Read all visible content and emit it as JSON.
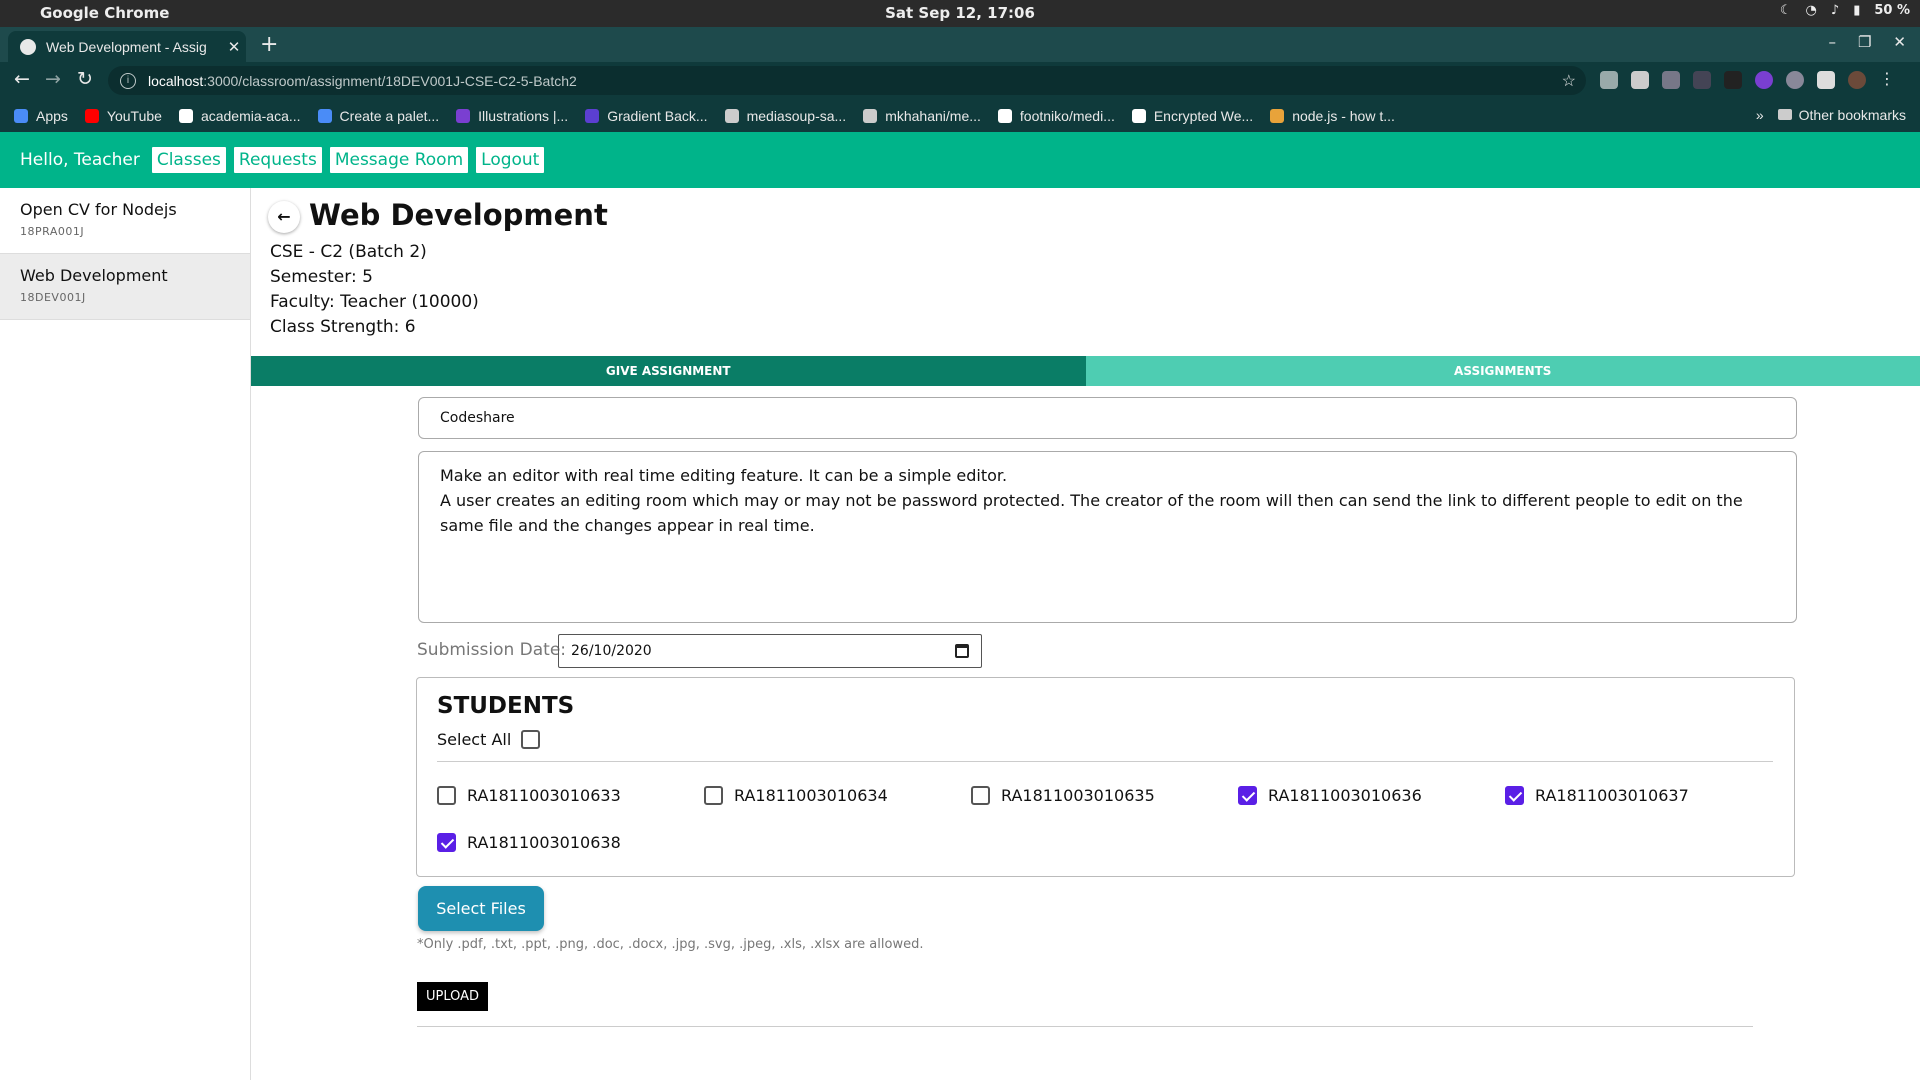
{
  "os": {
    "app_name": "Google Chrome",
    "clock": "Sat Sep 12, 17:06",
    "battery": "50 %"
  },
  "browser": {
    "tab_title": "Web Development - Assig",
    "url_host": "localhost",
    "url_rest": ":3000/classroom/assignment/18DEV001J-CSE-C2-5-Batch2",
    "bookmarks": [
      {
        "label": "Apps",
        "color": "#4a8cf7"
      },
      {
        "label": "YouTube",
        "color": "#ff0000"
      },
      {
        "label": "academia-aca...",
        "color": "#ffffff"
      },
      {
        "label": "Create a palet...",
        "color": "#4a8cf7"
      },
      {
        "label": "Illustrations |...",
        "color": "#7a3fd1"
      },
      {
        "label": "Gradient Back...",
        "color": "#5b3fd1"
      },
      {
        "label": "mediasoup-sa...",
        "color": "#cccccc"
      },
      {
        "label": "mkhahani/me...",
        "color": "#cccccc"
      },
      {
        "label": "footniko/medi...",
        "color": "#ffffff"
      },
      {
        "label": "Encrypted We...",
        "color": "#ffffff"
      },
      {
        "label": "node.js - how t...",
        "color": "#e8a33a"
      }
    ],
    "other_bookmarks": "Other bookmarks",
    "more": "»"
  },
  "header": {
    "greeting": "Hello, Teacher",
    "nav": [
      "Classes",
      "Requests",
      "Message Room",
      "Logout"
    ]
  },
  "sidebar": {
    "items": [
      {
        "name": "Open CV for Nodejs",
        "code": "18PRA001J",
        "active": false
      },
      {
        "name": "Web Development",
        "code": "18DEV001J",
        "active": true
      }
    ]
  },
  "course": {
    "title": "Web Development",
    "section": "CSE - C2 (Batch 2)",
    "semester": "Semester: 5",
    "faculty": "Faculty: Teacher (10000)",
    "strength": "Class Strength: 6"
  },
  "tabs": {
    "give": "GIVE ASSIGNMENT",
    "list": "ASSIGNMENTS"
  },
  "form": {
    "title_value": "Codeshare",
    "description_lines": [
      "Make an editor with real time editing feature. It can be a simple editor.",
      "A user creates an editing room which may or may not be password protected. The creator of the room will then can send the link to different people to edit on the same file and the changes appear in real time."
    ],
    "submission_label": "Submission Date:",
    "submission_date": "26/10/2020"
  },
  "students": {
    "heading": "STUDENTS",
    "select_all_label": "Select All",
    "select_all_checked": false,
    "list": [
      {
        "id": "RA1811003010633",
        "checked": false
      },
      {
        "id": "RA1811003010634",
        "checked": false
      },
      {
        "id": "RA1811003010635",
        "checked": false
      },
      {
        "id": "RA1811003010636",
        "checked": true
      },
      {
        "id": "RA1811003010637",
        "checked": true
      },
      {
        "id": "RA1811003010638",
        "checked": true
      }
    ]
  },
  "files": {
    "select_label": "Select Files",
    "allowed_note": "*Only .pdf, .txt, .ppt, .png, .doc, .docx, .jpg, .svg, .jpeg, .xls, .xlsx are allowed.",
    "upload_label": "UPLOAD"
  },
  "colors": {
    "brand": "#00b48a",
    "tab_active": "#0a7d66",
    "tab_inactive": "#4ecdb2",
    "checkbox": "#5a1fe6",
    "select_files": "#1e8fb0"
  }
}
